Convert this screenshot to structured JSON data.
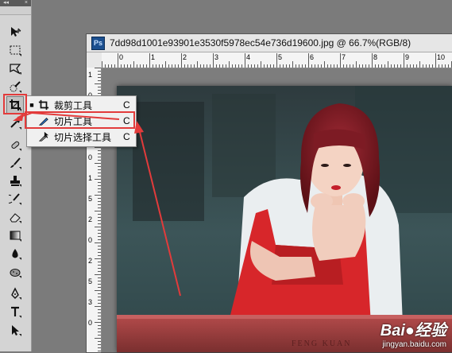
{
  "toolbar": {
    "collapse_glyph": "◂◂",
    "close_glyph": "×",
    "tools": [
      {
        "name": "move-tool",
        "icon": "move-icon"
      },
      {
        "name": "marquee-tool",
        "icon": "marquee-icon"
      },
      {
        "name": "lasso-tool",
        "icon": "lasso-icon"
      },
      {
        "name": "quick-select-tool",
        "icon": "quick-select-icon"
      },
      {
        "name": "crop-tool",
        "icon": "crop-icon",
        "active": true
      },
      {
        "name": "eyedropper-tool",
        "icon": "eyedropper-icon"
      },
      {
        "name": "healing-brush-tool",
        "icon": "healing-brush-icon"
      },
      {
        "name": "brush-tool",
        "icon": "brush-icon"
      },
      {
        "name": "clone-stamp-tool",
        "icon": "clone-stamp-icon"
      },
      {
        "name": "history-brush-tool",
        "icon": "history-brush-icon"
      },
      {
        "name": "eraser-tool",
        "icon": "eraser-icon"
      },
      {
        "name": "gradient-tool",
        "icon": "gradient-icon"
      },
      {
        "name": "blur-tool",
        "icon": "blur-icon"
      },
      {
        "name": "dodge-tool",
        "icon": "sponge-icon"
      },
      {
        "name": "pen-tool",
        "icon": "pen-icon"
      },
      {
        "name": "type-tool",
        "icon": "type-icon"
      },
      {
        "name": "path-select-tool",
        "icon": "arrow-icon"
      }
    ]
  },
  "document": {
    "ps_badge": "Ps",
    "title": "7dd98d1001e93901e3530f5978ec54e736d19600.jpg @ 66.7%(RGB/8)"
  },
  "ruler": {
    "h_labels": [
      "0",
      "1",
      "2",
      "3",
      "4",
      "5",
      "6",
      "7",
      "8",
      "9",
      "10",
      "11",
      "12",
      "13",
      "14",
      "15",
      "16",
      "17",
      "18",
      "19",
      "20",
      "21",
      "22",
      "23",
      "24",
      "25"
    ],
    "v_labels": [
      "1",
      "0",
      "5",
      "1",
      "0",
      "1",
      "5",
      "2",
      "0",
      "2",
      "5",
      "3",
      "0"
    ]
  },
  "flyout": {
    "items": [
      {
        "label": "裁剪工具",
        "shortcut": "C",
        "selected": true
      },
      {
        "label": "切片工具",
        "shortcut": "C",
        "selected": false
      },
      {
        "label": "切片选择工具",
        "shortcut": "C",
        "selected": false
      }
    ],
    "bullet": "■"
  },
  "watermark": {
    "brand": "Bai",
    "brand_tail": "经验",
    "url": "jingyan.baidu.com",
    "photo_text": "FENG KUAN"
  },
  "colors": {
    "highlight": "#e23b3b",
    "ps_badge": "#1b4f8f"
  }
}
